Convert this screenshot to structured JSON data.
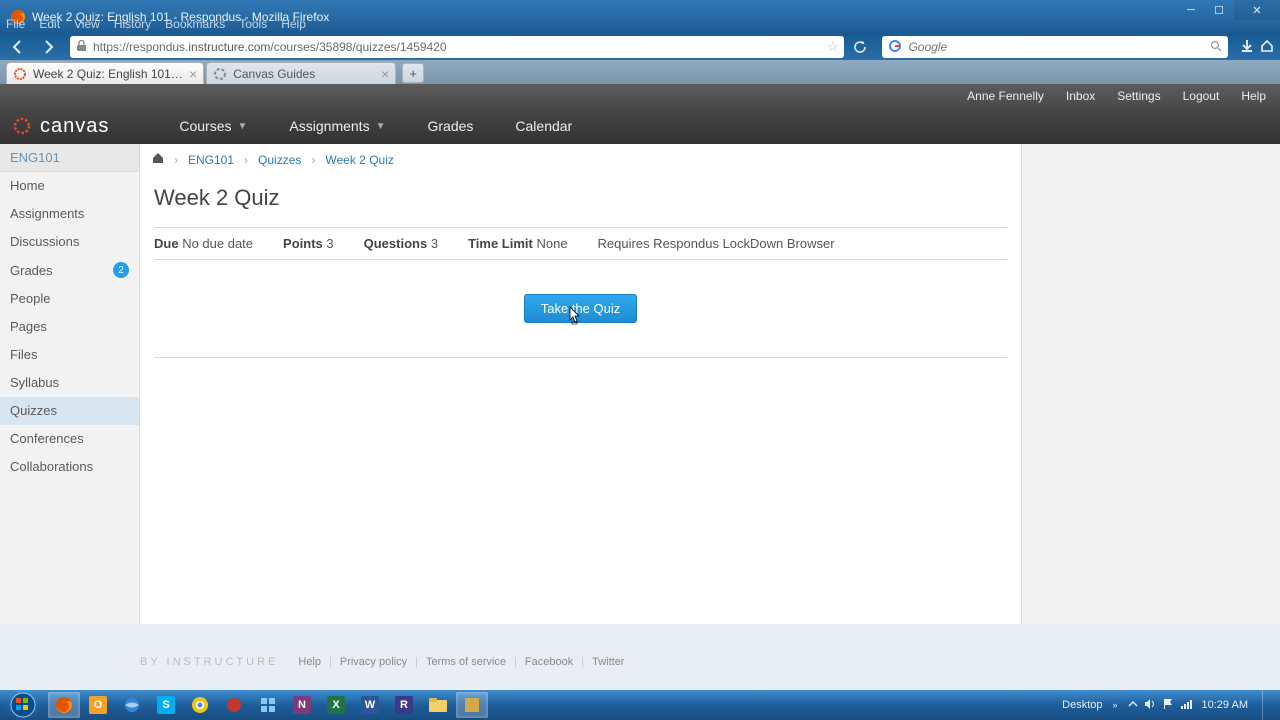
{
  "window": {
    "title": "Week 2 Quiz: English 101 - Respondus - Mozilla Firefox",
    "menu": [
      "File",
      "Edit",
      "View",
      "History",
      "Bookmarks",
      "Tools",
      "Help"
    ]
  },
  "browser": {
    "url_prefix": "https://respondus.",
    "url_host": "instructure.com",
    "url_path": "/courses/35898/quizzes/1459420",
    "search_placeholder": "Google"
  },
  "tabs": [
    {
      "label": "Week 2 Quiz: English 101 - Respondus",
      "active": true
    },
    {
      "label": "Canvas Guides",
      "active": false
    }
  ],
  "userbar": {
    "user": "Anne Fennelly",
    "links": [
      "Inbox",
      "Settings",
      "Logout",
      "Help"
    ]
  },
  "header": {
    "logo": "canvas",
    "nav": [
      "Courses",
      "Assignments",
      "Grades",
      "Calendar"
    ]
  },
  "sidebar": {
    "course_code": "ENG101",
    "items": [
      "Home",
      "Assignments",
      "Discussions",
      "Grades",
      "People",
      "Pages",
      "Files",
      "Syllabus",
      "Quizzes",
      "Conferences",
      "Collaborations"
    ],
    "grades_badge": "2",
    "active_index": 8
  },
  "breadcrumb": [
    "ENG101",
    "Quizzes",
    "Week 2 Quiz"
  ],
  "quiz": {
    "title": "Week 2 Quiz",
    "due_label": "Due",
    "due_value": "No due date",
    "points_label": "Points",
    "points_value": "3",
    "questions_label": "Questions",
    "questions_value": "3",
    "timelimit_label": "Time Limit",
    "timelimit_value": "None",
    "requires": "Requires Respondus LockDown Browser",
    "take_button": "Take the Quiz"
  },
  "footer": {
    "byline": "BY INSTRUCTURE",
    "links": [
      "Help",
      "Privacy policy",
      "Terms of service",
      "Facebook",
      "Twitter"
    ]
  },
  "taskbar": {
    "desktop_label": "Desktop",
    "clock": "10:29 AM"
  }
}
